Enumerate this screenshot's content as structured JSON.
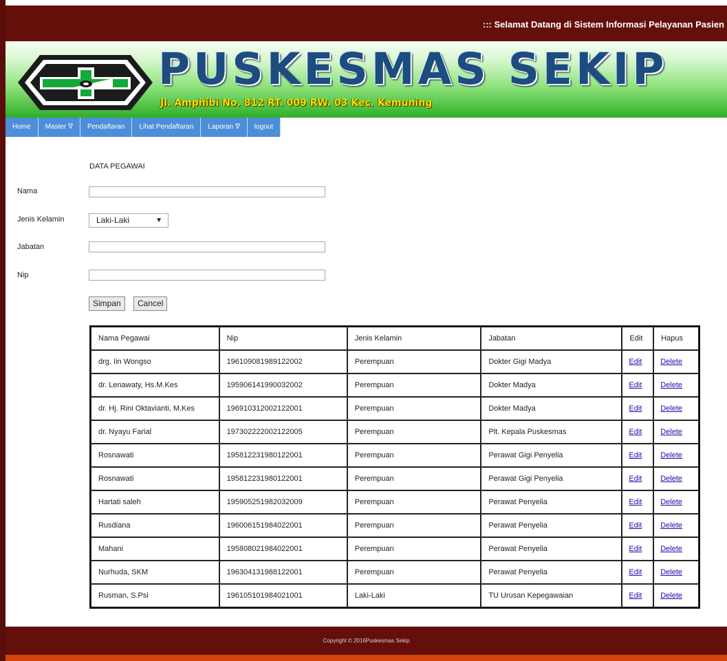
{
  "header": {
    "welcome_text": "::: Selamat Datang di Sistem Informasi Pelayanan Pasien"
  },
  "banner": {
    "title": "PUSKESMAS SEKIP",
    "address": "Jl. Amphibi No. 812 RT. 009 RW. 03 Kec. Kemuning",
    "logo_icon": "puskesmas-cross-logo-icon"
  },
  "nav": {
    "items": [
      {
        "label": "Home",
        "arrow": ""
      },
      {
        "label": "Master",
        "arrow": "∇"
      },
      {
        "label": "Pendaftaran",
        "arrow": ""
      },
      {
        "label": "Lihat Pendaftaran",
        "arrow": ""
      },
      {
        "label": "Laporan",
        "arrow": "∇"
      },
      {
        "label": "logout",
        "arrow": ""
      }
    ]
  },
  "form": {
    "title": "DATA PEGAWAI",
    "nama_label": "Nama",
    "nama_value": "",
    "jenis_kelamin_label": "Jenis Kelamin",
    "jenis_kelamin_selected": "Laki-Laki",
    "jabatan_label": "Jabatan",
    "jabatan_value": "",
    "nip_label": "Nip",
    "nip_value": "",
    "save_label": "Simpan",
    "cancel_label": "Cancel"
  },
  "table": {
    "headers": [
      "Nama Pegawai",
      "Nip",
      "Jenis Kelamin",
      "Jabatan",
      "Edit",
      "Hapus"
    ],
    "rows": [
      [
        "drg. Iin Wongso",
        "196109081989122002",
        "Perempuan",
        "Dokter Gigi Madya",
        "Edit",
        "Delete"
      ],
      [
        "dr. Lenawaty, Hs.M.Kes",
        "195906141990032002",
        "Perempuan",
        "Dokter Madya",
        "Edit",
        "Delete"
      ],
      [
        "dr. Hj. Rini Oktavianti, M.Kes",
        "196910312002122001",
        "Perempuan",
        "Dokter Madya",
        "Edit",
        "Delete"
      ],
      [
        "dr. Nyayu Farial",
        "197302222002122005",
        "Perempuan",
        "Plt. Kepala Puskesmas",
        "Edit",
        "Delete"
      ],
      [
        "Rosnawati",
        "195812231980122001",
        "Perempuan",
        "Perawat Gigi Penyelia",
        "Edit",
        "Delete"
      ],
      [
        "Rosnawati",
        "195812231980122001",
        "Perempuan",
        "Perawat Gigi Penyelia",
        "Edit",
        "Delete"
      ],
      [
        "Hartati saleh",
        "195905251982032009",
        "Perempuan",
        "Perawat Penyelia",
        "Edit",
        "Delete"
      ],
      [
        "Rusdiana",
        "196006151984022001",
        "Perempuan",
        "Perawat Penyelia",
        "Edit",
        "Delete"
      ],
      [
        "Mahani",
        "195808021984022001",
        "Perempuan",
        "Perawat Penyelia",
        "Edit",
        "Delete"
      ],
      [
        "Nurhuda, SKM",
        "196304131988122001",
        "Perempuan",
        "Perawat Penyelia",
        "Edit",
        "Delete"
      ],
      [
        "Rusman, S.Psi",
        "196105101984021001",
        "Laki-Laki",
        "TU Urusan Kepegawaian",
        "Edit",
        "Delete"
      ]
    ]
  },
  "footer": {
    "text": "Copyright © 2016Puskesmas Sekip"
  }
}
